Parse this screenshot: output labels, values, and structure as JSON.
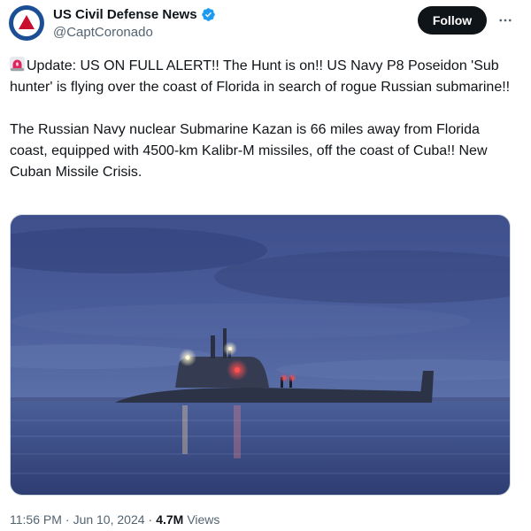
{
  "author": {
    "display_name": "US Civil Defense News",
    "handle": "@CaptCoronado",
    "verified": true,
    "avatar": "civil-defense-logo"
  },
  "actions": {
    "follow_label": "Follow",
    "more_icon": "more-horizontal-icon"
  },
  "tweet": {
    "alert_icon": "rotating-light-emoji",
    "paragraph1": "Update: US ON FULL ALERT!! The Hunt is on!! US Navy P8 Poseidon 'Sub hunter' is flying over the coast of Florida in search of rogue Russian submarine!!",
    "paragraph2": "The Russian Navy nuclear Submarine Kazan is 66 miles away from Florida coast, equipped with 4500-km Kalibr-M missiles, off the coast of Cuba!! New Cuban Missile Crisis."
  },
  "media": {
    "subject": "submarine-photo"
  },
  "meta": {
    "time": "11:56 PM",
    "separator1": "·",
    "date": "Jun 10, 2024",
    "separator2": "·",
    "views_count": "4.7M",
    "views_label": "Views"
  },
  "colors": {
    "accent_blue": "#1d9bf0",
    "text_primary": "#0f1419",
    "text_secondary": "#536471",
    "button_dark": "#0f1419"
  }
}
